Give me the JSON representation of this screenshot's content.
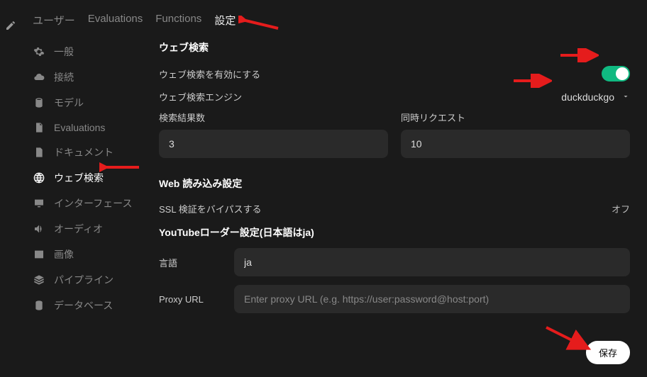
{
  "tabs": {
    "users": "ユーザー",
    "evaluations": "Evaluations",
    "functions": "Functions",
    "settings": "設定"
  },
  "sidebar": {
    "items": [
      {
        "label": "一般"
      },
      {
        "label": "接続"
      },
      {
        "label": "モデル"
      },
      {
        "label": "Evaluations"
      },
      {
        "label": "ドキュメント"
      },
      {
        "label": "ウェブ検索"
      },
      {
        "label": "インターフェース"
      },
      {
        "label": "オーディオ"
      },
      {
        "label": "画像"
      },
      {
        "label": "パイプライン"
      },
      {
        "label": "データベース"
      }
    ]
  },
  "webSearch": {
    "title": "ウェブ検索",
    "enableLabel": "ウェブ検索を有効にする",
    "engineLabel": "ウェブ検索エンジン",
    "engineValue": "duckduckgo",
    "resultsLabel": "検索結果数",
    "resultsValue": "3",
    "concurrentLabel": "同時リクエスト",
    "concurrentValue": "10"
  },
  "webLoad": {
    "title": "Web 読み込み設定",
    "sslBypassLabel": "SSL 検証をバイパスする",
    "sslBypassValue": "オフ"
  },
  "youtube": {
    "title": "YouTubeローダー設定(日本語はja)",
    "langLabel": "言語",
    "langValue": "ja",
    "proxyLabel": "Proxy URL",
    "proxyPlaceholder": "Enter proxy URL (e.g. https://user:password@host:port)"
  },
  "saveLabel": "保存"
}
